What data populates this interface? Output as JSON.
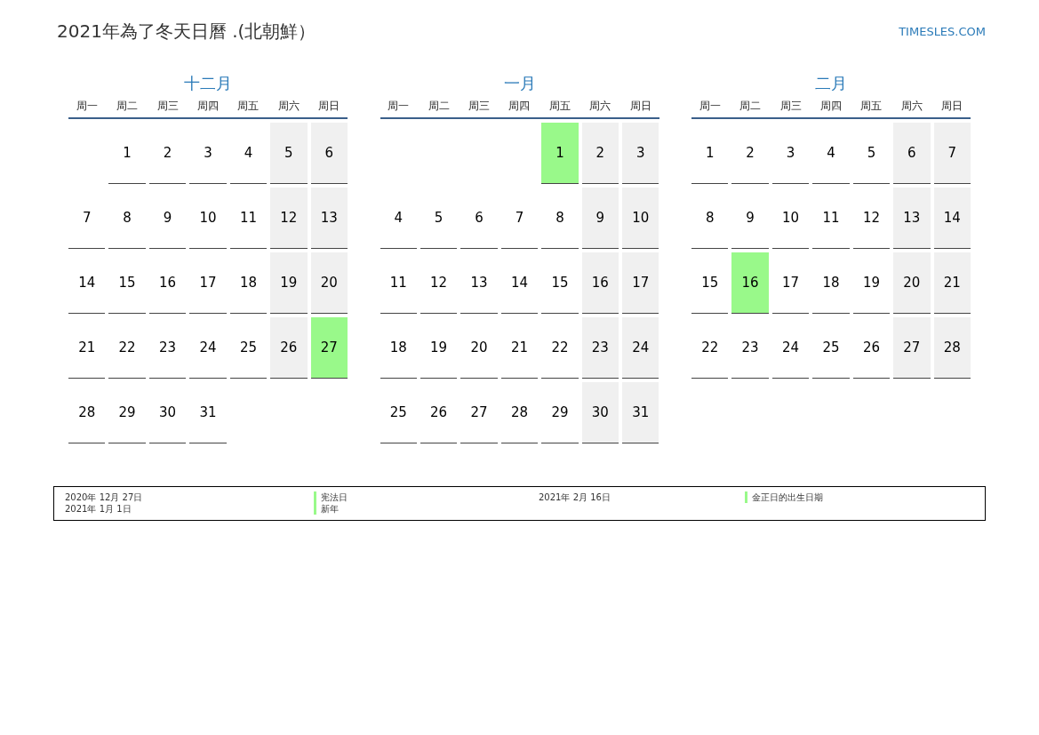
{
  "title": "2021年為了冬天日曆 .(北朝鮮）",
  "site": "TIMESLES.COM",
  "months": [
    {
      "name": "十二月",
      "weekdays": [
        "周一",
        "周二",
        "周三",
        "周四",
        "周五",
        "周六",
        "周日"
      ],
      "weeks": [
        [
          {
            "kind": "blank"
          },
          {
            "kind": "weekday",
            "day": "1",
            "holiday": false
          },
          {
            "kind": "weekday",
            "day": "2",
            "holiday": false
          },
          {
            "kind": "weekday",
            "day": "3",
            "holiday": false
          },
          {
            "kind": "weekday",
            "day": "4",
            "holiday": false
          },
          {
            "kind": "weekend",
            "day": "5",
            "holiday": false
          },
          {
            "kind": "weekend",
            "day": "6",
            "holiday": false
          }
        ],
        [
          {
            "kind": "weekday",
            "day": "7",
            "holiday": false
          },
          {
            "kind": "weekday",
            "day": "8",
            "holiday": false
          },
          {
            "kind": "weekday",
            "day": "9",
            "holiday": false
          },
          {
            "kind": "weekday",
            "day": "10",
            "holiday": false
          },
          {
            "kind": "weekday",
            "day": "11",
            "holiday": false
          },
          {
            "kind": "weekend",
            "day": "12",
            "holiday": false
          },
          {
            "kind": "weekend",
            "day": "13",
            "holiday": false
          }
        ],
        [
          {
            "kind": "weekday",
            "day": "14",
            "holiday": false
          },
          {
            "kind": "weekday",
            "day": "15",
            "holiday": false
          },
          {
            "kind": "weekday",
            "day": "16",
            "holiday": false
          },
          {
            "kind": "weekday",
            "day": "17",
            "holiday": false
          },
          {
            "kind": "weekday",
            "day": "18",
            "holiday": false
          },
          {
            "kind": "weekend",
            "day": "19",
            "holiday": false
          },
          {
            "kind": "weekend",
            "day": "20",
            "holiday": false
          }
        ],
        [
          {
            "kind": "weekday",
            "day": "21",
            "holiday": false
          },
          {
            "kind": "weekday",
            "day": "22",
            "holiday": false
          },
          {
            "kind": "weekday",
            "day": "23",
            "holiday": false
          },
          {
            "kind": "weekday",
            "day": "24",
            "holiday": false
          },
          {
            "kind": "weekday",
            "day": "25",
            "holiday": false
          },
          {
            "kind": "weekend",
            "day": "26",
            "holiday": false
          },
          {
            "kind": "weekend",
            "day": "27",
            "holiday": true
          }
        ],
        [
          {
            "kind": "weekday",
            "day": "28",
            "holiday": false
          },
          {
            "kind": "weekday",
            "day": "29",
            "holiday": false
          },
          {
            "kind": "weekday",
            "day": "30",
            "holiday": false
          },
          {
            "kind": "weekday",
            "day": "31",
            "holiday": false
          }
        ]
      ]
    },
    {
      "name": "一月",
      "weekdays": [
        "周一",
        "周二",
        "周三",
        "周四",
        "周五",
        "周六",
        "周日"
      ],
      "weeks": [
        [
          {
            "kind": "blank"
          },
          {
            "kind": "blank"
          },
          {
            "kind": "blank"
          },
          {
            "kind": "blank"
          },
          {
            "kind": "weekday",
            "day": "1",
            "holiday": true
          },
          {
            "kind": "weekend",
            "day": "2",
            "holiday": false
          },
          {
            "kind": "weekend",
            "day": "3",
            "holiday": false
          }
        ],
        [
          {
            "kind": "weekday",
            "day": "4",
            "holiday": false
          },
          {
            "kind": "weekday",
            "day": "5",
            "holiday": false
          },
          {
            "kind": "weekday",
            "day": "6",
            "holiday": false
          },
          {
            "kind": "weekday",
            "day": "7",
            "holiday": false
          },
          {
            "kind": "weekday",
            "day": "8",
            "holiday": false
          },
          {
            "kind": "weekend",
            "day": "9",
            "holiday": false
          },
          {
            "kind": "weekend",
            "day": "10",
            "holiday": false
          }
        ],
        [
          {
            "kind": "weekday",
            "day": "11",
            "holiday": false
          },
          {
            "kind": "weekday",
            "day": "12",
            "holiday": false
          },
          {
            "kind": "weekday",
            "day": "13",
            "holiday": false
          },
          {
            "kind": "weekday",
            "day": "14",
            "holiday": false
          },
          {
            "kind": "weekday",
            "day": "15",
            "holiday": false
          },
          {
            "kind": "weekend",
            "day": "16",
            "holiday": false
          },
          {
            "kind": "weekend",
            "day": "17",
            "holiday": false
          }
        ],
        [
          {
            "kind": "weekday",
            "day": "18",
            "holiday": false
          },
          {
            "kind": "weekday",
            "day": "19",
            "holiday": false
          },
          {
            "kind": "weekday",
            "day": "20",
            "holiday": false
          },
          {
            "kind": "weekday",
            "day": "21",
            "holiday": false
          },
          {
            "kind": "weekday",
            "day": "22",
            "holiday": false
          },
          {
            "kind": "weekend",
            "day": "23",
            "holiday": false
          },
          {
            "kind": "weekend",
            "day": "24",
            "holiday": false
          }
        ],
        [
          {
            "kind": "weekday",
            "day": "25",
            "holiday": false
          },
          {
            "kind": "weekday",
            "day": "26",
            "holiday": false
          },
          {
            "kind": "weekday",
            "day": "27",
            "holiday": false
          },
          {
            "kind": "weekday",
            "day": "28",
            "holiday": false
          },
          {
            "kind": "weekday",
            "day": "29",
            "holiday": false
          },
          {
            "kind": "weekend",
            "day": "30",
            "holiday": false
          },
          {
            "kind": "weekend",
            "day": "31",
            "holiday": false
          }
        ]
      ]
    },
    {
      "name": "二月",
      "weekdays": [
        "周一",
        "周二",
        "周三",
        "周四",
        "周五",
        "周六",
        "周日"
      ],
      "weeks": [
        [
          {
            "kind": "weekday",
            "day": "1",
            "holiday": false
          },
          {
            "kind": "weekday",
            "day": "2",
            "holiday": false
          },
          {
            "kind": "weekday",
            "day": "3",
            "holiday": false
          },
          {
            "kind": "weekday",
            "day": "4",
            "holiday": false
          },
          {
            "kind": "weekday",
            "day": "5",
            "holiday": false
          },
          {
            "kind": "weekend",
            "day": "6",
            "holiday": false
          },
          {
            "kind": "weekend",
            "day": "7",
            "holiday": false
          }
        ],
        [
          {
            "kind": "weekday",
            "day": "8",
            "holiday": false
          },
          {
            "kind": "weekday",
            "day": "9",
            "holiday": false
          },
          {
            "kind": "weekday",
            "day": "10",
            "holiday": false
          },
          {
            "kind": "weekday",
            "day": "11",
            "holiday": false
          },
          {
            "kind": "weekday",
            "day": "12",
            "holiday": false
          },
          {
            "kind": "weekend",
            "day": "13",
            "holiday": false
          },
          {
            "kind": "weekend",
            "day": "14",
            "holiday": false
          }
        ],
        [
          {
            "kind": "weekday",
            "day": "15",
            "holiday": false
          },
          {
            "kind": "weekday",
            "day": "16",
            "holiday": true
          },
          {
            "kind": "weekday",
            "day": "17",
            "holiday": false
          },
          {
            "kind": "weekday",
            "day": "18",
            "holiday": false
          },
          {
            "kind": "weekday",
            "day": "19",
            "holiday": false
          },
          {
            "kind": "weekend",
            "day": "20",
            "holiday": false
          },
          {
            "kind": "weekend",
            "day": "21",
            "holiday": false
          }
        ],
        [
          {
            "kind": "weekday",
            "day": "22",
            "holiday": false
          },
          {
            "kind": "weekday",
            "day": "23",
            "holiday": false
          },
          {
            "kind": "weekday",
            "day": "24",
            "holiday": false
          },
          {
            "kind": "weekday",
            "day": "25",
            "holiday": false
          },
          {
            "kind": "weekday",
            "day": "26",
            "holiday": false
          },
          {
            "kind": "weekend",
            "day": "27",
            "holiday": false
          },
          {
            "kind": "weekend",
            "day": "28",
            "holiday": false
          }
        ]
      ]
    }
  ],
  "legend": [
    {
      "date": "2020年 12月 27日",
      "name": "宪法日"
    },
    {
      "date": "2021年 2月 16日",
      "name": "金正日的出生日期"
    },
    {
      "date": "2021年 1月 1日",
      "name": "新年"
    }
  ]
}
